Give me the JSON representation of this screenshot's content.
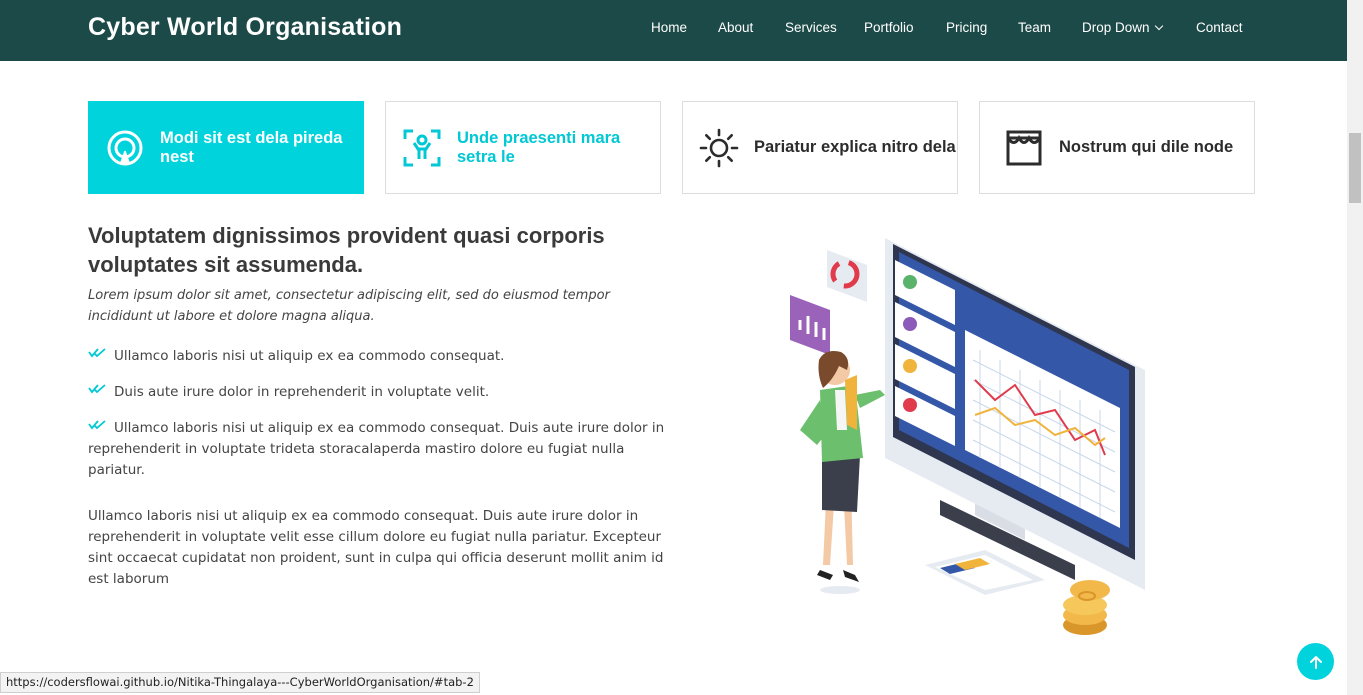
{
  "header": {
    "logo": "Cyber World Organisation",
    "nav": [
      {
        "label": "Home"
      },
      {
        "label": "About"
      },
      {
        "label": "Services"
      },
      {
        "label": "Portfolio"
      },
      {
        "label": "Pricing"
      },
      {
        "label": "Team"
      },
      {
        "label": "Drop Down",
        "icon": "chevron-down-icon"
      },
      {
        "label": "Contact"
      }
    ]
  },
  "tabs": [
    {
      "label": "Modi sit est dela pireda nest",
      "icon": "signal-target-icon",
      "state": "active"
    },
    {
      "label": "Unde praesenti mara setra le",
      "icon": "person-scan-icon",
      "state": "hover"
    },
    {
      "label": "Pariatur explica nitro dela",
      "icon": "sun-icon",
      "state": "normal"
    },
    {
      "label": "Nostrum qui dile node",
      "icon": "store-icon",
      "state": "normal"
    }
  ],
  "content": {
    "heading": "Voluptatem dignissimos provident quasi corporis voluptates sit assumenda.",
    "intro": "Lorem ipsum dolor sit amet, consectetur adipiscing elit, sed do eiusmod tempor incididunt ut labore et dolore magna aliqua.",
    "checklist": [
      "Ullamco laboris nisi ut aliquip ex ea commodo consequat.",
      "Duis aute irure dolor in reprehenderit in voluptate velit.",
      "Ullamco laboris nisi ut aliquip ex ea commodo consequat. Duis aute irure dolor in reprehenderit in voluptate trideta storacalaperda mastiro dolore eu fugiat nulla pariatur."
    ],
    "paragraph": "Ullamco laboris nisi ut aliquip ex ea commodo consequat. Duis aute irure dolor in reprehenderit in voluptate velit esse cillum dolore eu fugiat nulla pariatur. Excepteur sint occaecat cupidatat non proident, sunt in culpa qui officia deserunt mollit anim id est laborum"
  },
  "status_url": "https://codersflowai.github.io/Nitika-Thingalaya---CyberWorldOrganisation/#tab-2",
  "colors": {
    "header_bg": "#1c4a48",
    "accent": "#00d3dc"
  }
}
